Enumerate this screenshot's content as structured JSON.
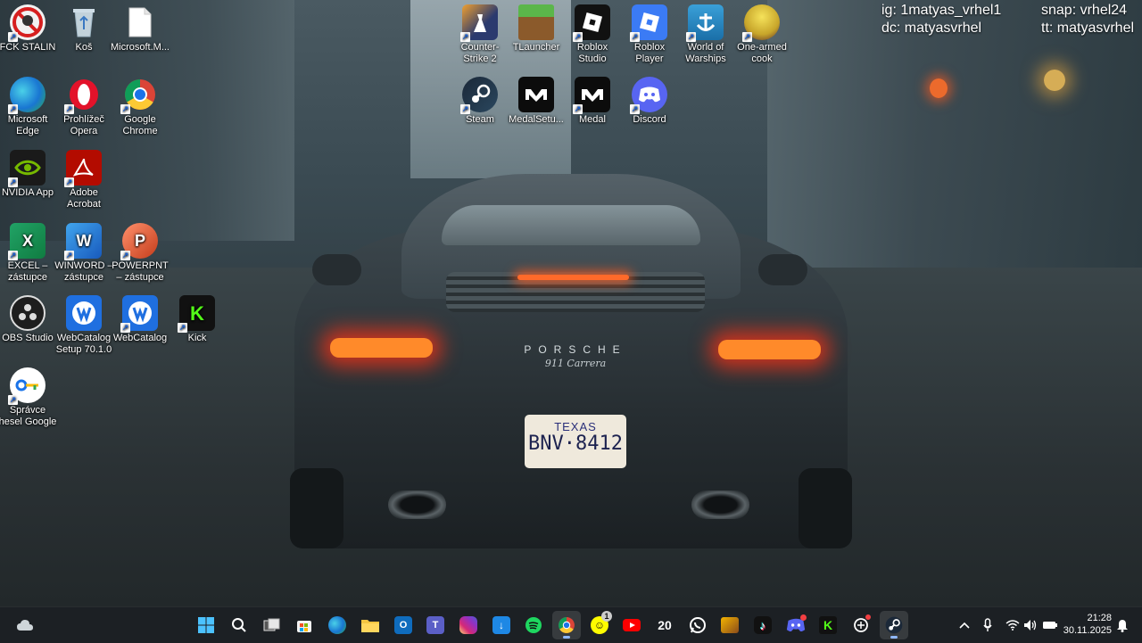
{
  "overlay": {
    "instagram": "ig: 1matyas_vrhel1",
    "snapchat": "snap: vrhel24",
    "discord": "dc: matyasvrhel",
    "tiktok": "tt: matyasvrhel"
  },
  "wallpaper": {
    "car_brand": "PORSCHE",
    "car_model": "911 Carrera",
    "plate_state": "TEXAS",
    "plate_number": "BNV·8412"
  },
  "desktop_icons": {
    "fck_stalin": "FCK STALIN",
    "kos": "Koš",
    "microsoft_m": "Microsoft.M...",
    "edge": "Microsoft Edge",
    "opera": "Prohlížeč Opera",
    "chrome": "Google Chrome",
    "nvidia": "NVIDIA App",
    "acrobat": "Adobe Acrobat",
    "excel": "EXCEL – zástupce",
    "winword": "WINWORD – zástupce",
    "powerpnt": "POWERPNT – zástupce",
    "obs": "OBS Studio",
    "webcatalog_setup": "WebCatalog Setup 70.1.0",
    "webcatalog": "WebCatalog",
    "kick": "Kick",
    "password_manager": "Správce hesel Google",
    "counter_strike": "Counter-Strike 2",
    "tlauncher": "TLauncher",
    "roblox_studio": "Roblox Studio",
    "roblox_player": "Roblox Player",
    "world_of_warships": "World of Warships",
    "one_armed_cook": "One-armed cook",
    "steam": "Steam",
    "medal_setup": "MedalSetu...",
    "medal": "Medal",
    "discord": "Discord"
  },
  "taskbar": {
    "temperature": "20",
    "badge_count": "1",
    "time": "21:28",
    "date": "30.11.2025"
  },
  "colors": {
    "taskbar_bg": "#1c2024",
    "accent": "#8fb8ff"
  }
}
